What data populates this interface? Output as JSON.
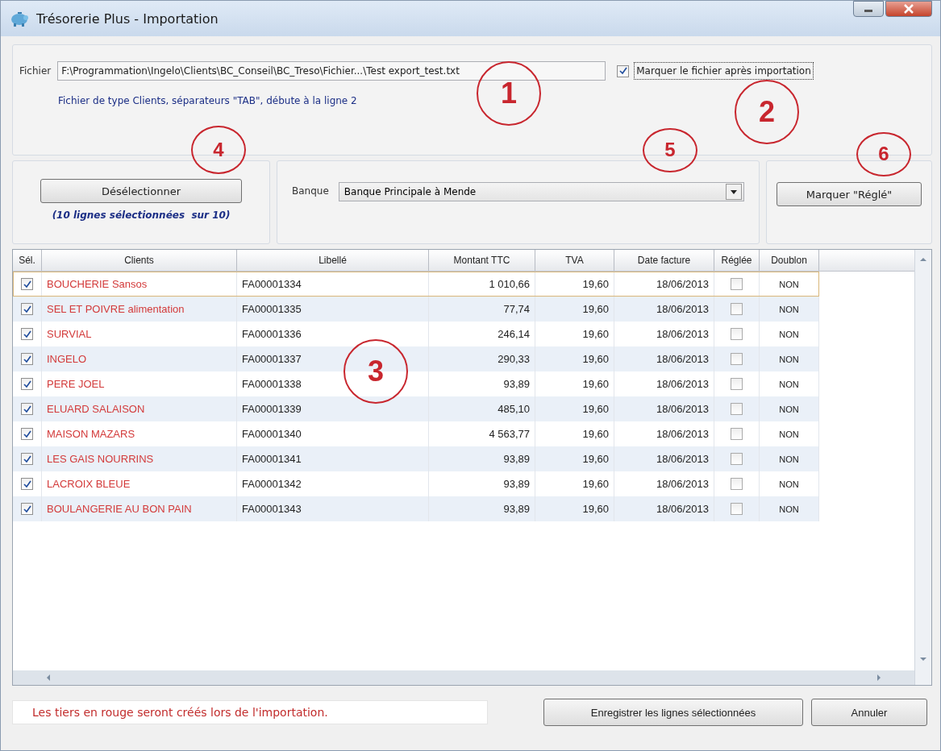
{
  "window": {
    "title": "Trésorerie Plus - Importation"
  },
  "file": {
    "label": "Fichier",
    "value": "F:\\Programmation\\Ingelo\\Clients\\BC_Conseil\\BC_Treso\\Fichier...\\Test export_test.txt",
    "mark_after_import": {
      "label": "Marquer le fichier après importation",
      "checked": true
    },
    "info": "Fichier de type Clients, séparateurs \"TAB\", débute à la ligne 2"
  },
  "selection": {
    "button": "Désélectionner",
    "count": "(10 lignes sélectionnées  sur 10)"
  },
  "bank": {
    "label": "Banque",
    "value": "Banque Principale à Mende"
  },
  "mark_button": "Marquer \"Réglé\"",
  "table": {
    "columns": [
      "Sél.",
      "Clients",
      "Libellé",
      "Montant TTC",
      "TVA",
      "Date facture",
      "Réglée",
      "Doublon"
    ],
    "rows": [
      {
        "checked": true,
        "client": "BOUCHERIE Sansos",
        "new_tier": true,
        "label": "FA00001334",
        "amount": "1 010,66",
        "vat": "19,60",
        "date": "18/06/2013",
        "settled": false,
        "duplicate": "NON",
        "current": true
      },
      {
        "checked": true,
        "client": "SEL ET POIVRE alimentation",
        "new_tier": true,
        "label": "FA00001335",
        "amount": "77,74",
        "vat": "19,60",
        "date": "18/06/2013",
        "settled": false,
        "duplicate": "NON",
        "current": false
      },
      {
        "checked": true,
        "client": "SURVIAL",
        "new_tier": true,
        "label": "FA00001336",
        "amount": "246,14",
        "vat": "19,60",
        "date": "18/06/2013",
        "settled": false,
        "duplicate": "NON",
        "current": false
      },
      {
        "checked": true,
        "client": "INGELO",
        "new_tier": true,
        "label": "FA00001337",
        "amount": "290,33",
        "vat": "19,60",
        "date": "18/06/2013",
        "settled": false,
        "duplicate": "NON",
        "current": false
      },
      {
        "checked": true,
        "client": "PERE JOEL",
        "new_tier": true,
        "label": "FA00001338",
        "amount": "93,89",
        "vat": "19,60",
        "date": "18/06/2013",
        "settled": false,
        "duplicate": "NON",
        "current": false
      },
      {
        "checked": true,
        "client": "ELUARD SALAISON",
        "new_tier": true,
        "label": "FA00001339",
        "amount": "485,10",
        "vat": "19,60",
        "date": "18/06/2013",
        "settled": false,
        "duplicate": "NON",
        "current": false
      },
      {
        "checked": true,
        "client": "MAISON MAZARS",
        "new_tier": true,
        "label": "FA00001340",
        "amount": "4 563,77",
        "vat": "19,60",
        "date": "18/06/2013",
        "settled": false,
        "duplicate": "NON",
        "current": false
      },
      {
        "checked": true,
        "client": "LES GAIS NOURRINS",
        "new_tier": true,
        "label": "FA00001341",
        "amount": "93,89",
        "vat": "19,60",
        "date": "18/06/2013",
        "settled": false,
        "duplicate": "NON",
        "current": false
      },
      {
        "checked": true,
        "client": "LACROIX BLEUE",
        "new_tier": true,
        "label": "FA00001342",
        "amount": "93,89",
        "vat": "19,60",
        "date": "18/06/2013",
        "settled": false,
        "duplicate": "NON",
        "current": false
      },
      {
        "checked": true,
        "client": "BOULANGERIE AU BON PAIN",
        "new_tier": true,
        "label": "FA00001343",
        "amount": "93,89",
        "vat": "19,60",
        "date": "18/06/2013",
        "settled": false,
        "duplicate": "NON",
        "current": false
      }
    ]
  },
  "footer": {
    "note": "Les tiers en rouge seront créés lors de l'importation.",
    "buttons": [
      "Enregistrer les lignes sélectionnées",
      "Annuler"
    ]
  },
  "annotations": [
    "1",
    "2",
    "3",
    "4",
    "5",
    "6"
  ]
}
